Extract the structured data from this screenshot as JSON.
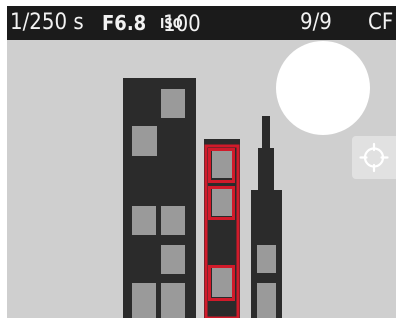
{
  "status_bar": {
    "shutter_speed": "1/250 s",
    "aperture": "F6.8",
    "iso_label": "ISO",
    "iso_value": "100",
    "frame_counter": "9/9",
    "card": "CF"
  },
  "scene": {
    "background_color": "#cfcfcf",
    "building_color": "#2b2b2b",
    "window_color": "#9a9a9a",
    "sun_color": "#ffffff"
  },
  "focus_fields": {
    "active_color": "#d11a2a",
    "active_count": 3
  },
  "icons": {
    "focus": "crosshair-icon"
  }
}
